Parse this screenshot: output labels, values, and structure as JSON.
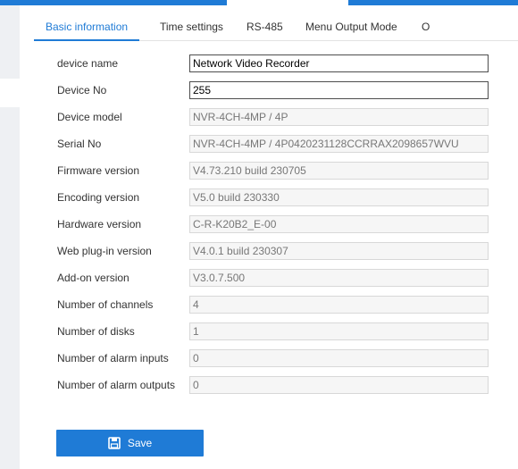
{
  "colors": {
    "accent": "#1f7bd6",
    "gutter": "#eef0f3"
  },
  "tabs": [
    {
      "label": "Basic information",
      "active": true
    },
    {
      "label": "Time settings",
      "active": false
    },
    {
      "label": "RS-485",
      "active": false
    },
    {
      "label": "Menu Output Mode",
      "active": false
    },
    {
      "label": "O",
      "active": false
    }
  ],
  "form": {
    "device_name": {
      "label": "device name",
      "value": "Network Video Recorder",
      "editable": true
    },
    "device_no": {
      "label": "Device No",
      "value": "255",
      "editable": true
    },
    "device_model": {
      "label": "Device model",
      "value": "NVR-4CH-4MP / 4P",
      "editable": false
    },
    "serial_no": {
      "label": "Serial No",
      "value": "NVR-4CH-4MP / 4P0420231128CCRRAX2098657WVU",
      "editable": false
    },
    "firmware_version": {
      "label": "Firmware version",
      "value": "V4.73.210 build 230705",
      "editable": false
    },
    "encoding_version": {
      "label": "Encoding version",
      "value": "V5.0 build 230330",
      "editable": false
    },
    "hardware_version": {
      "label": "Hardware version",
      "value": "C-R-K20B2_E-00",
      "editable": false
    },
    "web_plugin_version": {
      "label": "Web plug-in version",
      "value": "V4.0.1 build 230307",
      "editable": false
    },
    "addon_version": {
      "label": "Add-on version",
      "value": "V3.0.7.500",
      "editable": false
    },
    "num_channels": {
      "label": "Number of channels",
      "value": "4",
      "editable": false
    },
    "num_disks": {
      "label": "Number of disks",
      "value": "1",
      "editable": false
    },
    "num_alarm_inputs": {
      "label": "Number of alarm inputs",
      "value": "0",
      "editable": false
    },
    "num_alarm_outputs": {
      "label": "Number of alarm outputs",
      "value": "0",
      "editable": false
    }
  },
  "save_button": {
    "label": "Save",
    "icon": "floppy-disk-icon"
  }
}
